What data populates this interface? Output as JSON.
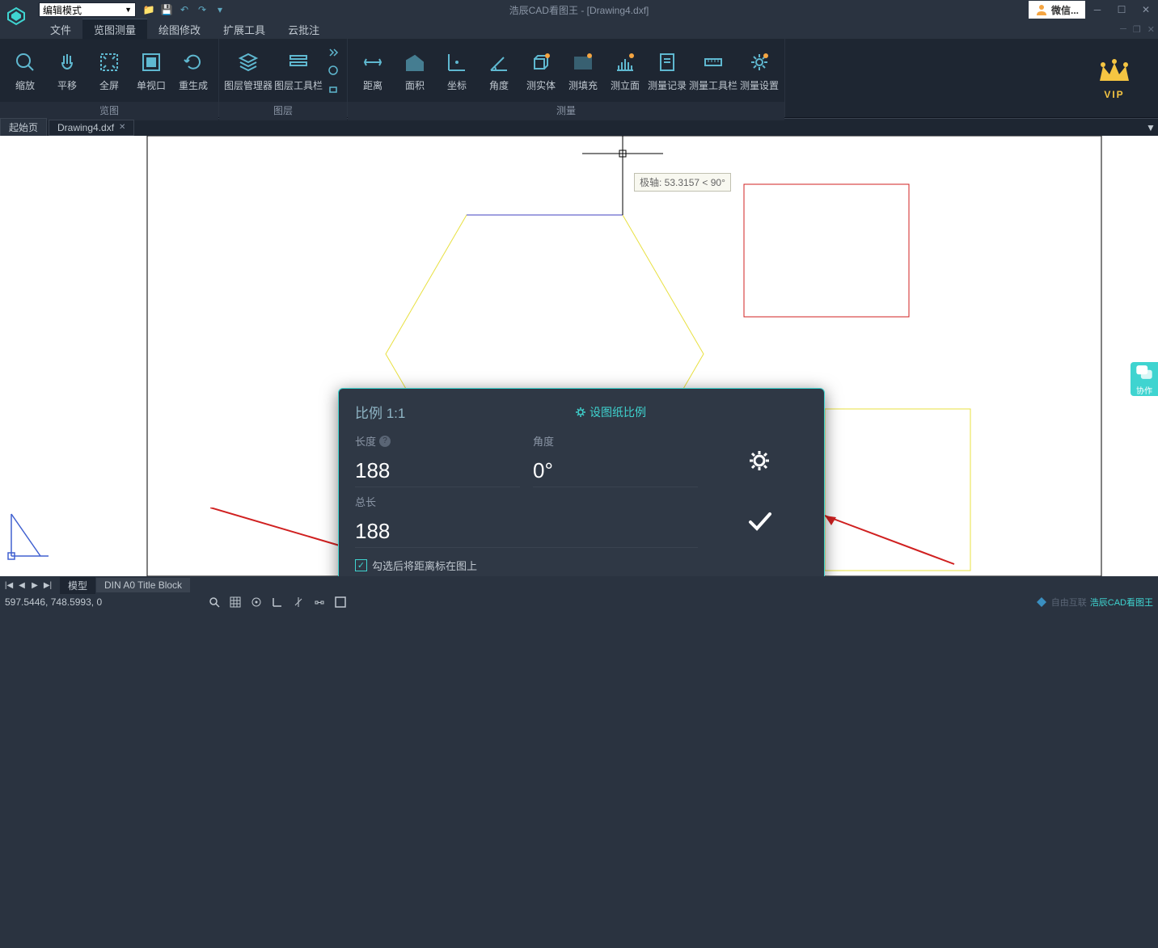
{
  "title": {
    "app": "浩辰CAD看图王",
    "doc": "[Drawing4.dxf]"
  },
  "mode_select": "编辑模式",
  "account": "微信...",
  "menu": {
    "file": "文件",
    "view_measure": "览图测量",
    "draw_edit": "绘图修改",
    "ext_tools": "扩展工具",
    "cloud_annot": "云批注"
  },
  "ribbon": {
    "group_view": "览图",
    "group_layer": "图层",
    "group_measure": "测量",
    "zoom": "缩放",
    "pan": "平移",
    "fullscreen": "全屏",
    "single_viewport": "单视口",
    "regen": "重生成",
    "layer_manager": "图层管理器",
    "layer_toolbar": "图层工具栏",
    "distance": "距离",
    "area": "面积",
    "coord": "坐标",
    "angle": "角度",
    "solid": "测实体",
    "fill": "测填充",
    "section": "测立面",
    "record": "测量记录",
    "measure_toolbar": "测量工具栏",
    "measure_settings": "测量设置",
    "vip": "VIP"
  },
  "doc_tabs": {
    "start": "起始页",
    "current": "Drawing4.dxf"
  },
  "tooltip": "极轴: 53.3157 < 90°",
  "measure_popup": {
    "ratio": "比例 1:1",
    "set_ratio": "设图纸比例",
    "length_label": "长度",
    "length_value": "188",
    "angle_label": "角度",
    "angle_value": "0°",
    "total_label": "总长",
    "total_value": "188",
    "checkbox_label": "勾选后将距离标在图上"
  },
  "layout_tabs": {
    "model": "模型",
    "title_block": "DIN A0 Title Block"
  },
  "status": {
    "coords": "597.5446, 748.5993, 0"
  },
  "brand": "浩辰CAD看图王",
  "collab": "协作"
}
